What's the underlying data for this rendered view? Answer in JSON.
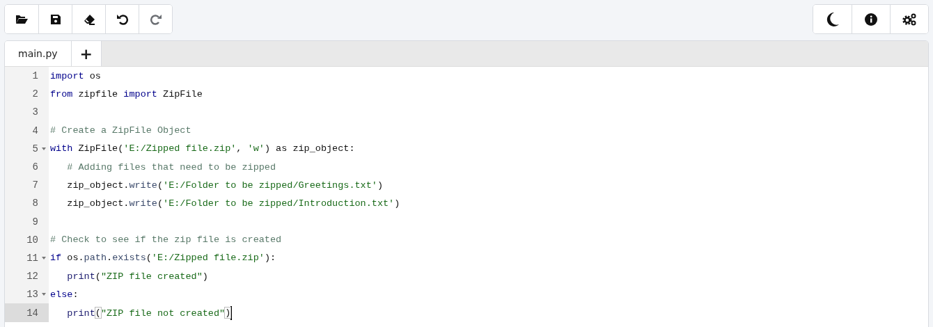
{
  "toolbar_left": [
    {
      "kind": "folder",
      "disabled": false
    },
    {
      "kind": "save",
      "disabled": false
    },
    {
      "kind": "eraser",
      "disabled": false
    },
    {
      "kind": "undo",
      "disabled": false
    },
    {
      "kind": "redo",
      "disabled": true
    }
  ],
  "toolbar_right": [
    {
      "kind": "moon"
    },
    {
      "kind": "info"
    },
    {
      "kind": "gears"
    }
  ],
  "tabs": [
    {
      "label": "main.py",
      "selected": true
    }
  ],
  "add_tab": {
    "label": "+"
  },
  "lines": [
    {
      "number": "1",
      "foldable": false,
      "active": false,
      "tokens": [
        {
          "kind": "keyword",
          "text": "import"
        },
        {
          "kind": "plain",
          "text": " os"
        }
      ]
    },
    {
      "number": "2",
      "foldable": false,
      "active": false,
      "tokens": [
        {
          "kind": "keyword",
          "text": "from"
        },
        {
          "kind": "plain",
          "text": " zipfile "
        },
        {
          "kind": "keyword",
          "text": "import"
        },
        {
          "kind": "plain",
          "text": " ZipFile"
        }
      ]
    },
    {
      "number": "3",
      "foldable": false,
      "active": false
    },
    {
      "number": "4",
      "foldable": false,
      "active": false,
      "tokens": [
        {
          "kind": "comment",
          "text": "# Create a ZipFile Object"
        }
      ]
    },
    {
      "number": "5",
      "foldable": true,
      "active": false,
      "tokens": [
        {
          "kind": "keyword",
          "text": "with"
        },
        {
          "kind": "plain",
          "text": " ZipFile("
        },
        {
          "kind": "string",
          "text": "'E:/Zipped file.zip'"
        },
        {
          "kind": "plain",
          "text": ", "
        },
        {
          "kind": "string",
          "text": "'w'"
        },
        {
          "kind": "plain",
          "text": ") as zip_object:"
        }
      ]
    },
    {
      "number": "6",
      "foldable": false,
      "active": false,
      "tokens": [
        {
          "kind": "comment",
          "text": "   # Adding files that need to be zipped"
        }
      ]
    },
    {
      "number": "7",
      "foldable": false,
      "active": false,
      "tokens": [
        {
          "kind": "plain",
          "text": "   zip_object."
        },
        {
          "kind": "method",
          "text": "write"
        },
        {
          "kind": "plain",
          "text": "("
        },
        {
          "kind": "string",
          "text": "'E:/Folder to be zipped/Greetings.txt'"
        },
        {
          "kind": "plain",
          "text": ")"
        }
      ]
    },
    {
      "number": "8",
      "foldable": false,
      "active": false,
      "tokens": [
        {
          "kind": "plain",
          "text": "   zip_object."
        },
        {
          "kind": "method",
          "text": "write"
        },
        {
          "kind": "plain",
          "text": "("
        },
        {
          "kind": "string",
          "text": "'E:/Folder to be zipped/Introduction.txt'"
        },
        {
          "kind": "plain",
          "text": ")"
        }
      ]
    },
    {
      "number": "9",
      "foldable": false,
      "active": false
    },
    {
      "number": "10",
      "foldable": false,
      "active": false,
      "tokens": [
        {
          "kind": "comment",
          "text": "# Check to see if the zip file is created"
        }
      ]
    },
    {
      "number": "11",
      "foldable": true,
      "active": false,
      "tokens": [
        {
          "kind": "keyword",
          "text": "if"
        },
        {
          "kind": "plain",
          "text": " os."
        },
        {
          "kind": "method",
          "text": "path"
        },
        {
          "kind": "plain",
          "text": "."
        },
        {
          "kind": "method",
          "text": "exists"
        },
        {
          "kind": "plain",
          "text": "("
        },
        {
          "kind": "string",
          "text": "'E:/Zipped file.zip'"
        },
        {
          "kind": "plain",
          "text": "):"
        }
      ]
    },
    {
      "number": "12",
      "foldable": false,
      "active": false,
      "tokens": [
        {
          "kind": "builtin",
          "text": "   print"
        },
        {
          "kind": "plain",
          "text": "("
        },
        {
          "kind": "string",
          "text": "\"ZIP file created\""
        },
        {
          "kind": "plain",
          "text": ")"
        }
      ]
    },
    {
      "number": "13",
      "foldable": true,
      "active": false,
      "tokens": [
        {
          "kind": "keyword",
          "text": "else"
        },
        {
          "kind": "plain",
          "text": ":"
        }
      ]
    },
    {
      "number": "14",
      "foldable": false,
      "active": true,
      "tokens": [
        {
          "kind": "builtin",
          "text": "   print"
        },
        {
          "kind": "bracket",
          "text": "("
        },
        {
          "kind": "string",
          "text": "\"ZIP file not created\""
        },
        {
          "kind": "bracket",
          "text": ")"
        }
      ]
    }
  ]
}
